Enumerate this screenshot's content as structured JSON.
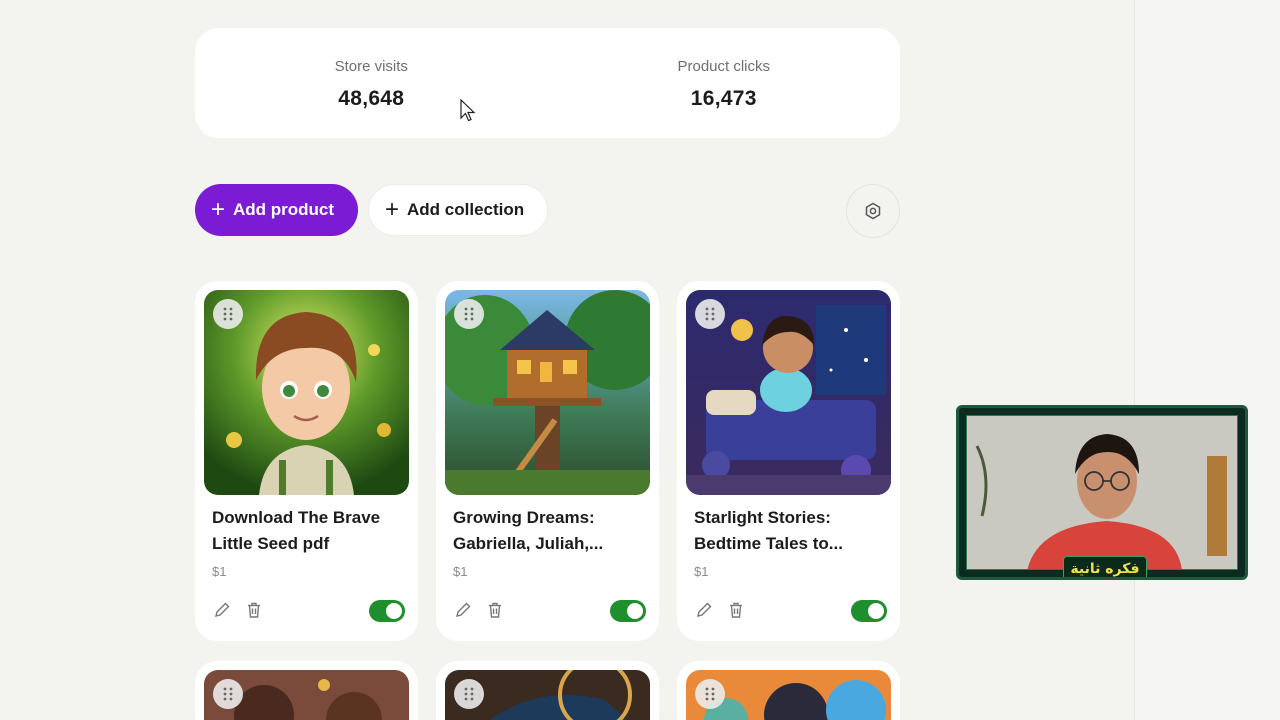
{
  "stats": {
    "visits": {
      "label": "Store visits",
      "value": "48,648"
    },
    "clicks": {
      "label": "Product clicks",
      "value": "16,473"
    }
  },
  "toolbar": {
    "add_product": "Add product",
    "add_collection": "Add collection"
  },
  "colors": {
    "accent": "#7c1bd4",
    "toggle_on": "#1f8f2e",
    "background": "#f3f3f0"
  },
  "products": [
    {
      "title": "Download The Brave Little Seed pdf",
      "price": "$1",
      "enabled": true
    },
    {
      "title": "Growing Dreams: Gabriella, Juliah,...",
      "price": "$1",
      "enabled": true
    },
    {
      "title": "Starlight Stories: Bedtime Tales to...",
      "price": "$1",
      "enabled": true
    }
  ],
  "webcam": {
    "caption": "فكره ثانية"
  }
}
